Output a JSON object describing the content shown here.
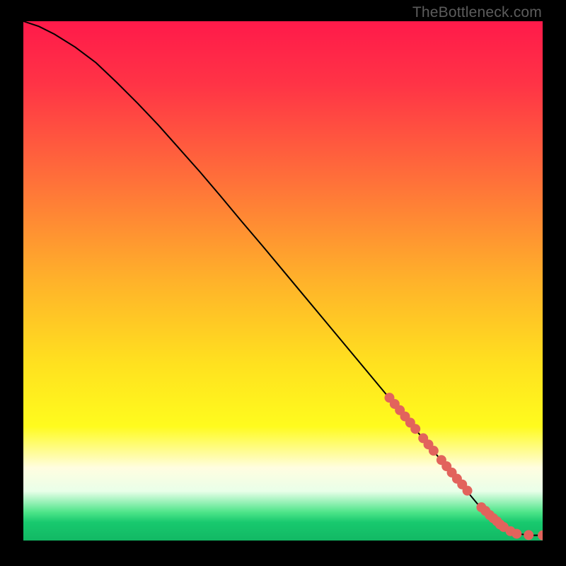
{
  "watermark": "TheBottleneck.com",
  "colors": {
    "curve_stroke": "#000000",
    "marker_fill": "#e2635c",
    "marker_stroke": "#e2635c",
    "gradient_stops": [
      {
        "offset": 0.0,
        "color": "#ff1a4a"
      },
      {
        "offset": 0.12,
        "color": "#ff3346"
      },
      {
        "offset": 0.3,
        "color": "#ff6e3a"
      },
      {
        "offset": 0.5,
        "color": "#ffb22a"
      },
      {
        "offset": 0.66,
        "color": "#ffe11f"
      },
      {
        "offset": 0.78,
        "color": "#fffb1e"
      },
      {
        "offset": 0.86,
        "color": "#fffde0"
      },
      {
        "offset": 0.905,
        "color": "#e9ffe9"
      },
      {
        "offset": 0.945,
        "color": "#4fe58a"
      },
      {
        "offset": 0.965,
        "color": "#18c96e"
      },
      {
        "offset": 1.0,
        "color": "#12b864"
      }
    ]
  },
  "chart_data": {
    "type": "line",
    "title": "",
    "xlabel": "",
    "ylabel": "",
    "xlim": [
      0,
      100
    ],
    "ylim": [
      0,
      100
    ],
    "grid": false,
    "series": [
      {
        "name": "curve",
        "x": [
          0,
          3,
          6,
          10,
          14,
          18,
          22,
          26,
          30,
          34,
          38,
          42,
          46,
          50,
          54,
          58,
          62,
          66,
          70,
          74,
          78,
          82,
          85,
          88,
          90,
          92,
          94,
          96,
          98,
          100
        ],
        "y": [
          100,
          99,
          97.5,
          95,
          92,
          88.2,
          84.2,
          80,
          75.5,
          71,
          66.3,
          61.5,
          56.8,
          52,
          47.2,
          42.4,
          37.6,
          32.8,
          28,
          23.2,
          18.4,
          13.6,
          10,
          6.4,
          4.3,
          2.8,
          1.8,
          1.2,
          1.0,
          1.0
        ]
      }
    ],
    "markers": [
      {
        "x": 70.5,
        "y": 27.5
      },
      {
        "x": 71.5,
        "y": 26.3
      },
      {
        "x": 72.5,
        "y": 25.1
      },
      {
        "x": 73.5,
        "y": 23.9
      },
      {
        "x": 74.5,
        "y": 22.7
      },
      {
        "x": 75.5,
        "y": 21.5
      },
      {
        "x": 77.0,
        "y": 19.7
      },
      {
        "x": 78.0,
        "y": 18.5
      },
      {
        "x": 79.0,
        "y": 17.3
      },
      {
        "x": 80.5,
        "y": 15.5
      },
      {
        "x": 81.5,
        "y": 14.3
      },
      {
        "x": 82.5,
        "y": 13.1
      },
      {
        "x": 83.5,
        "y": 11.9
      },
      {
        "x": 84.5,
        "y": 10.8
      },
      {
        "x": 85.5,
        "y": 9.6
      },
      {
        "x": 88.2,
        "y": 6.4
      },
      {
        "x": 89.0,
        "y": 5.7
      },
      {
        "x": 89.8,
        "y": 4.9
      },
      {
        "x": 90.5,
        "y": 4.3
      },
      {
        "x": 91.2,
        "y": 3.7
      },
      {
        "x": 91.8,
        "y": 3.1
      },
      {
        "x": 92.5,
        "y": 2.6
      },
      {
        "x": 93.8,
        "y": 1.8
      },
      {
        "x": 95.0,
        "y": 1.3
      },
      {
        "x": 97.3,
        "y": 1.05
      },
      {
        "x": 100.0,
        "y": 1.0
      }
    ]
  }
}
